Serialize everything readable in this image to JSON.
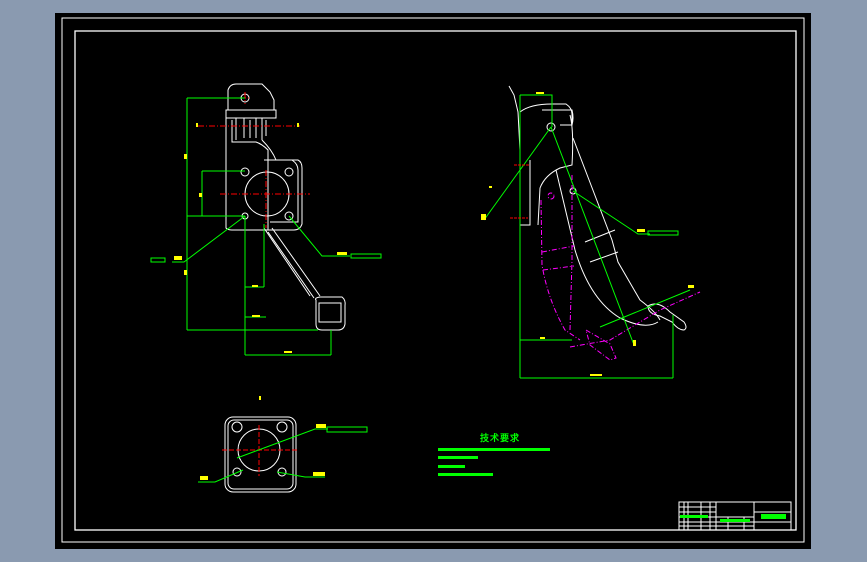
{
  "viewer": {
    "background_color": "#8a9ab0",
    "canvas_color": "#000000"
  },
  "drawing": {
    "technical_requirements_title": "技术要求",
    "colors": {
      "outline": "#ffffff",
      "dimension": "#00ff00",
      "centerline": "#ff0000",
      "annotation": "#ffff00",
      "phantom": "#ff00ff"
    }
  }
}
